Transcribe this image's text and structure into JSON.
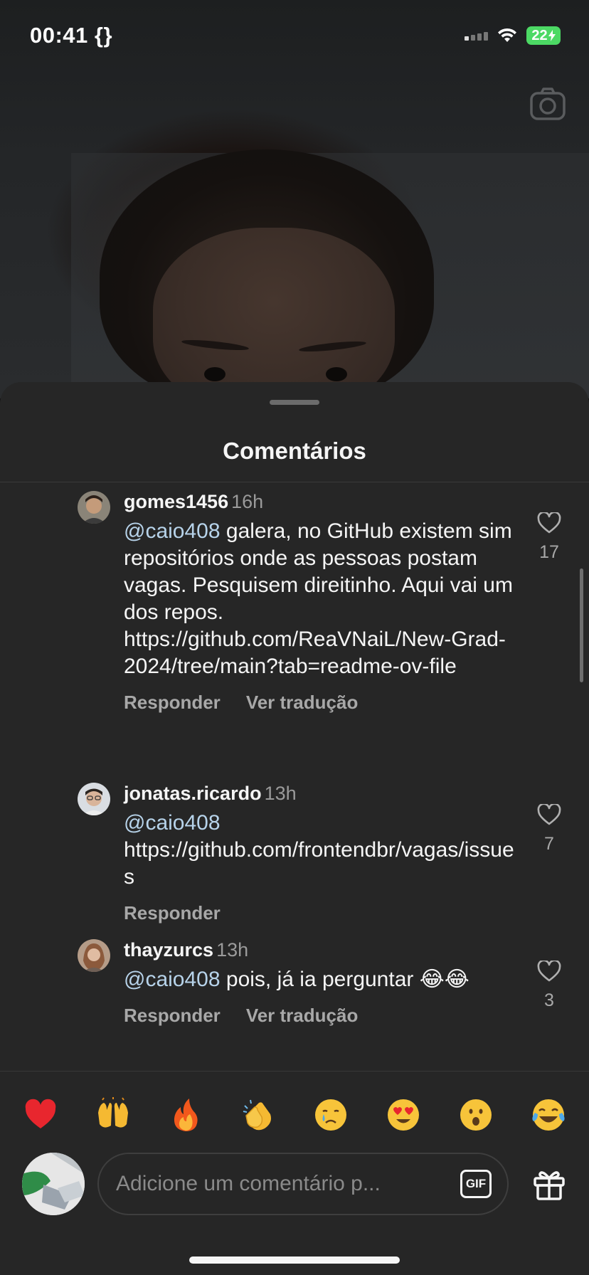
{
  "status_bar": {
    "time": "00:41 {}",
    "battery": "22"
  },
  "sheet": {
    "title": "Comentários"
  },
  "comments": [
    {
      "username": "gomes1456",
      "time": "16h",
      "mention": "@caio408",
      "text": " galera, no GitHub existem sim repositórios onde as pessoas postam vagas. Pesquisem direitinho. Aqui vai um dos repos.  https://github.com/ReaVNaiL/New-Grad-2024/tree/main?tab=readme-ov-file",
      "reply": "Responder",
      "translate": "Ver tradução",
      "likes": "17"
    },
    {
      "username": "jonatas.ricardo",
      "time": "13h",
      "mention": "@caio408",
      "text": " https://github.com/frontendbr/vagas/issues",
      "reply": "Responder",
      "likes": "7"
    },
    {
      "username": "thayzurcs",
      "time": "13h",
      "mention": "@caio408",
      "text": " pois, já ia perguntar 😂😂",
      "reply": "Responder",
      "translate": "Ver tradução",
      "likes": "3"
    }
  ],
  "emoji_bar": [
    "❤️",
    "🙌",
    "🔥",
    "👏",
    "😢",
    "😍",
    "😮",
    "😂"
  ],
  "composer": {
    "placeholder": "Adicione um comentário p...",
    "gif_label": "GIF"
  }
}
